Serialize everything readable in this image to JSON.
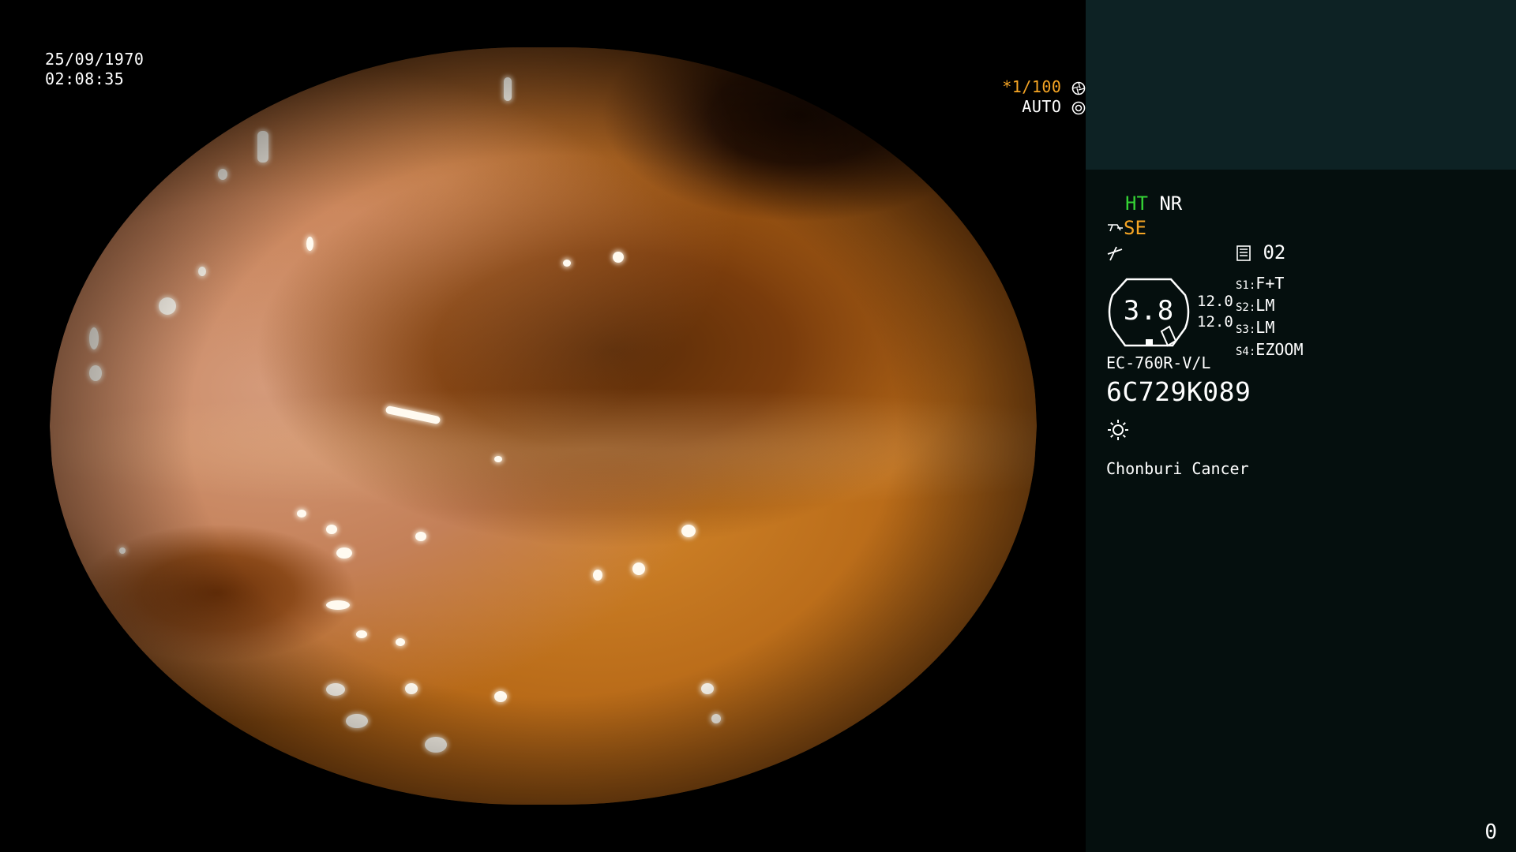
{
  "screen": {
    "date": "25/09/1970",
    "time": "02:08:35",
    "shutter_speed": "*1/100",
    "iris_mode": "AUTO"
  },
  "panel": {
    "enhancement_1": "HT",
    "enhancement_2": "NR",
    "structure_enhancement": "SE",
    "save_count": "02",
    "zoom_value": "3.8",
    "gauge_left_top": "12.0",
    "gauge_left_bottom": "12.0",
    "switches": [
      {
        "key": "S1:",
        "value": "F+T"
      },
      {
        "key": "S2:",
        "value": "LM"
      },
      {
        "key": "S3:",
        "value": "LM"
      },
      {
        "key": "S4:",
        "value": "EZOOM"
      }
    ],
    "scope_model": "EC-760R-V/L",
    "scope_serial": "6C729K089",
    "hospital": "Chonburi Cancer",
    "counter": "0"
  },
  "colors": {
    "accent_orange": "#f6a524",
    "accent_green": "#35d435",
    "panel_background": "#050f0e",
    "panel_header": "#0d2224"
  },
  "icons": {
    "shutter": "aperture-icon",
    "iris": "iris-ring-icon",
    "structure": "scope-tip-icon",
    "color": "noise-icon",
    "save": "memory-card-icon",
    "light": "light-source-icon"
  }
}
